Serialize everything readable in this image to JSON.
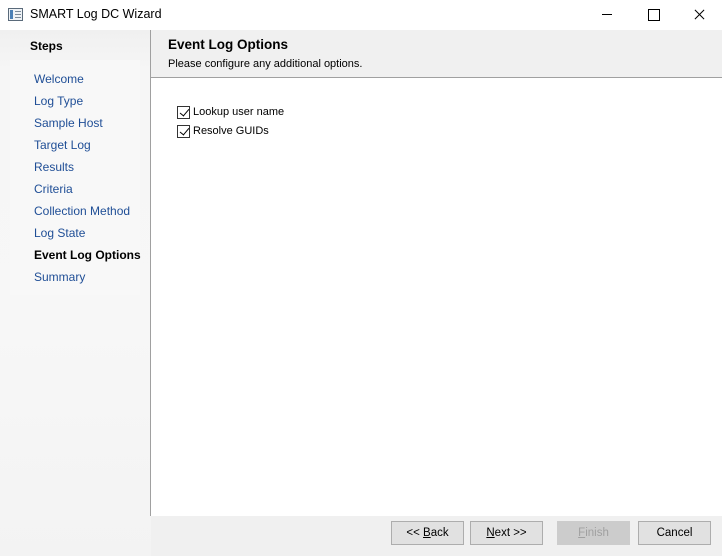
{
  "window": {
    "title": "SMART Log DC Wizard"
  },
  "steps": {
    "header": "Steps",
    "items": [
      {
        "label": "Welcome"
      },
      {
        "label": "Log Type"
      },
      {
        "label": "Sample Host"
      },
      {
        "label": "Target Log"
      },
      {
        "label": "Results"
      },
      {
        "label": "Criteria"
      },
      {
        "label": "Collection Method"
      },
      {
        "label": "Log State"
      },
      {
        "label": "Event Log Options",
        "current": true
      },
      {
        "label": "Summary"
      }
    ]
  },
  "content": {
    "title": "Event Log Options",
    "subtitle": "Please configure any additional options.",
    "options": [
      {
        "label": "Lookup user name",
        "checked": true
      },
      {
        "label": "Resolve GUIDs",
        "checked": true
      }
    ]
  },
  "footer": {
    "back": {
      "prefix": "<< ",
      "mnemonic": "B",
      "rest": "ack",
      "enabled": true
    },
    "next": {
      "mnemonic": "N",
      "rest": "ext >>",
      "enabled": true
    },
    "finish": {
      "mnemonic": "F",
      "rest": "inish",
      "enabled": false
    },
    "cancel": {
      "label": "Cancel",
      "enabled": true
    }
  },
  "colors": {
    "link": "#1f4e96",
    "panel_bg": "#f0f0f0",
    "divider": "#a0a0a0"
  }
}
